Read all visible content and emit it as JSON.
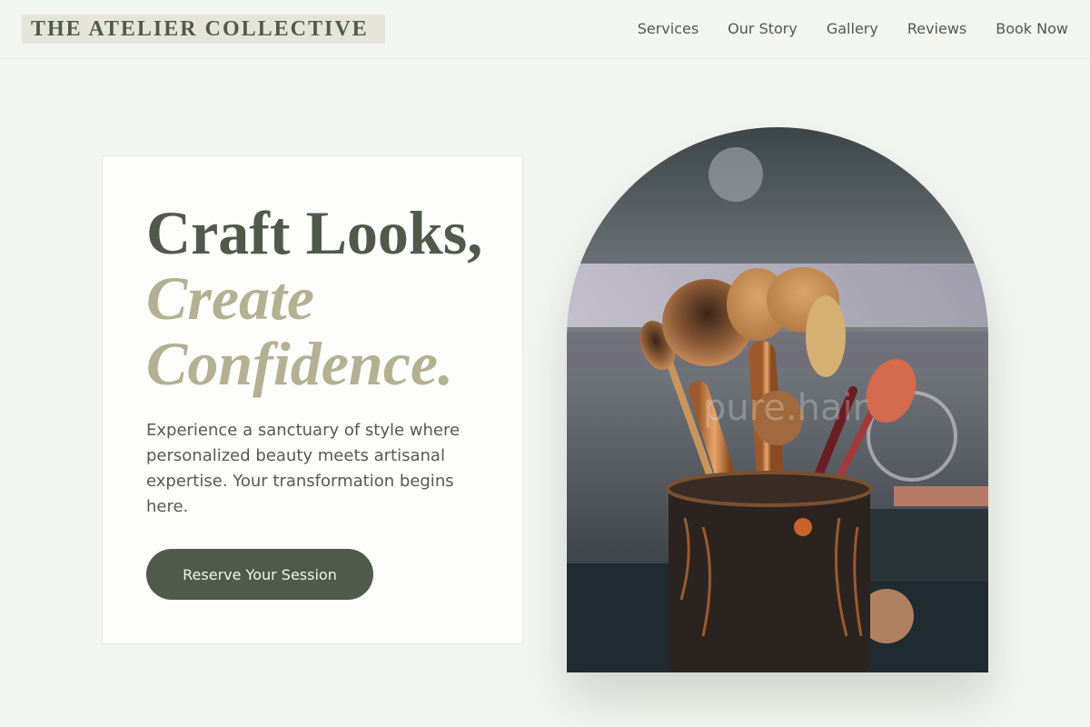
{
  "header": {
    "brand": "THE ATELIER COLLECTIVE",
    "nav": [
      "Services",
      "Our Story",
      "Gallery",
      "Reviews",
      "Book Now"
    ]
  },
  "hero": {
    "headline_line1": "Craft Looks,",
    "headline_line2": "Create",
    "headline_line3": "Confidence.",
    "description": "Experience a sanctuary of style where personalized beauty meets artisanal expertise. Your transformation begins here.",
    "cta_label": "Reserve Your Session"
  },
  "image": {
    "subject": "makeup brushes in a copper cup",
    "watermark": "pure.hair"
  },
  "colors": {
    "background": "#f3f5f0",
    "brand_box": "#e5e6d9",
    "primary": "#4f5a4b",
    "accent_italic": "#b4b092",
    "card": "#fdfdfb"
  }
}
